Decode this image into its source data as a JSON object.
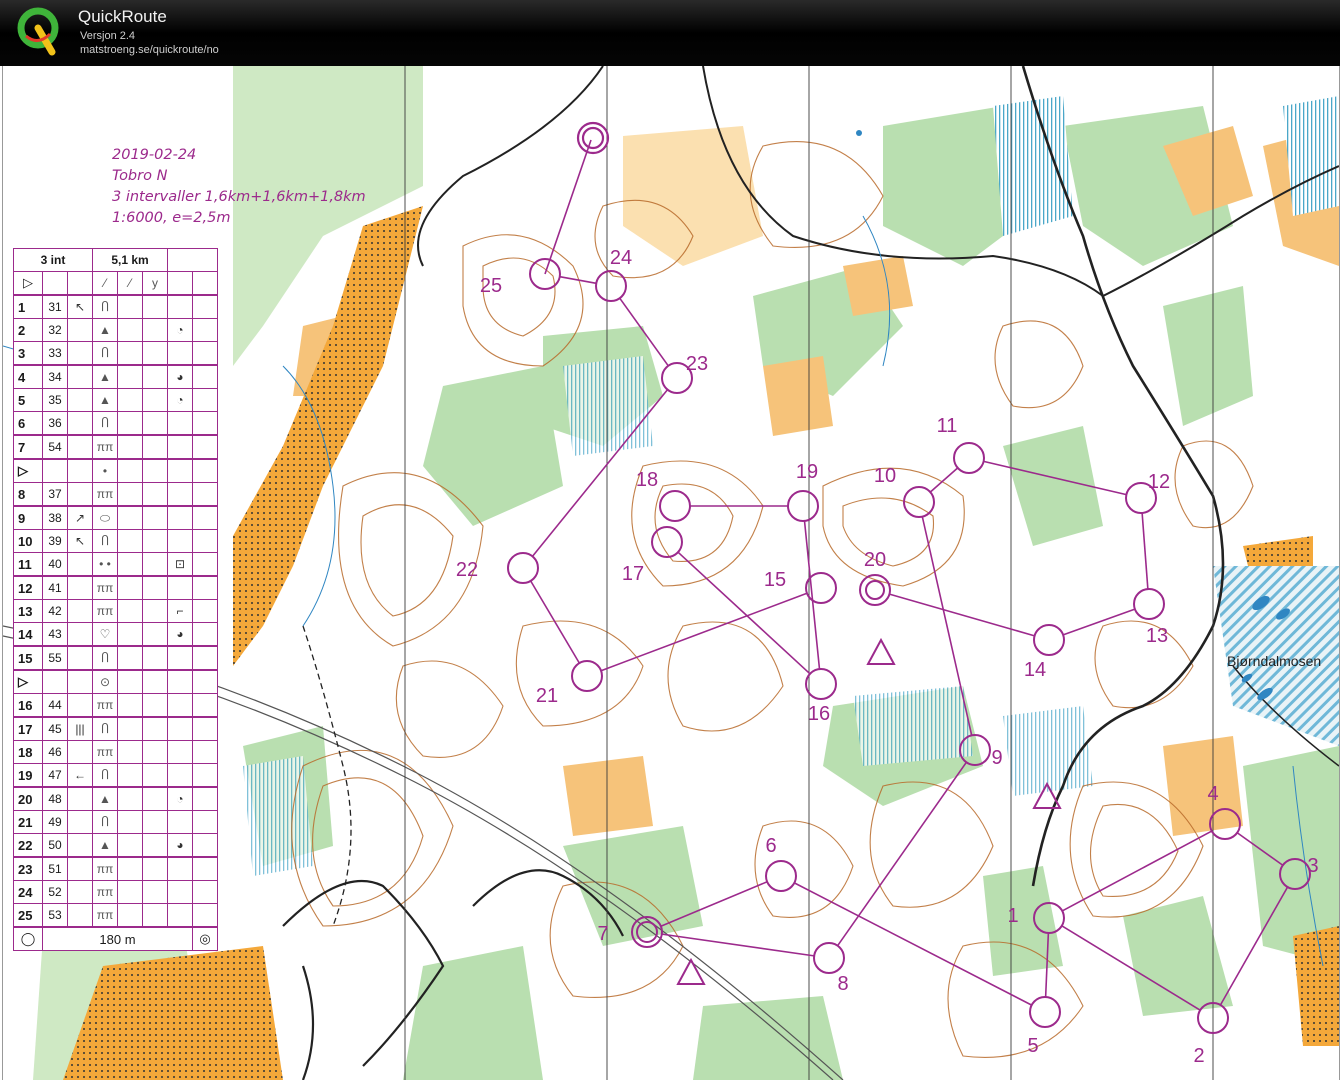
{
  "app": {
    "title": "QuickRoute",
    "version": "Versjon 2.4",
    "url": "matstroeng.se/quickroute/no"
  },
  "event": {
    "date": "2019-02-24",
    "area": "Tobro N",
    "description": "3 intervaller 1,6km+1,6km+1,8km",
    "scale": "1:6000,  e=2,5m"
  },
  "course_table": {
    "header": {
      "name": "3 int",
      "length": "5,1 km"
    },
    "footer": "180 m",
    "rows": [
      {
        "no": "1",
        "code": "31",
        "feat": "↖",
        "sym": "Ⴖ",
        "extra": ""
      },
      {
        "no": "2",
        "code": "32",
        "feat": "",
        "sym": "▲",
        "extra": "◔"
      },
      {
        "no": "3",
        "code": "33",
        "feat": "",
        "sym": "Ⴖ",
        "extra": ""
      },
      {
        "no": "4",
        "code": "34",
        "feat": "",
        "sym": "▲",
        "extra": "◕"
      },
      {
        "no": "5",
        "code": "35",
        "feat": "",
        "sym": "▲",
        "extra": "◔"
      },
      {
        "no": "6",
        "code": "36",
        "feat": "",
        "sym": "Ⴖ",
        "extra": ""
      },
      {
        "no": "7",
        "code": "54",
        "feat": "",
        "sym": "ππ",
        "extra": ""
      },
      {
        "no": "▷",
        "code": "",
        "feat": "",
        "sym": "•",
        "extra": ""
      },
      {
        "no": "8",
        "code": "37",
        "feat": "",
        "sym": "ππ",
        "extra": ""
      },
      {
        "no": "9",
        "code": "38",
        "feat": "↗",
        "sym": "⬭",
        "extra": ""
      },
      {
        "no": "10",
        "code": "39",
        "feat": "↖",
        "sym": "Ⴖ",
        "extra": ""
      },
      {
        "no": "11",
        "code": "40",
        "feat": "",
        "sym": "• •",
        "extra": "⊡"
      },
      {
        "no": "12",
        "code": "41",
        "feat": "",
        "sym": "ππ",
        "extra": ""
      },
      {
        "no": "13",
        "code": "42",
        "feat": "",
        "sym": "ππ",
        "extra": "⌐"
      },
      {
        "no": "14",
        "code": "43",
        "feat": "",
        "sym": "♡",
        "extra": "◕"
      },
      {
        "no": "15",
        "code": "55",
        "feat": "",
        "sym": "Ⴖ",
        "extra": ""
      },
      {
        "no": "▷",
        "code": "",
        "feat": "",
        "sym": "⊙",
        "extra": ""
      },
      {
        "no": "16",
        "code": "44",
        "feat": "",
        "sym": "ππ",
        "extra": ""
      },
      {
        "no": "17",
        "code": "45",
        "feat": "|||",
        "sym": "Ⴖ",
        "extra": ""
      },
      {
        "no": "18",
        "code": "46",
        "feat": "",
        "sym": "ππ",
        "extra": ""
      },
      {
        "no": "19",
        "code": "47",
        "feat": "←",
        "sym": "Ⴖ",
        "extra": ""
      },
      {
        "no": "20",
        "code": "48",
        "feat": "",
        "sym": "▲",
        "extra": "◔"
      },
      {
        "no": "21",
        "code": "49",
        "feat": "",
        "sym": "Ⴖ",
        "extra": ""
      },
      {
        "no": "22",
        "code": "50",
        "feat": "",
        "sym": "▲",
        "extra": "◕"
      },
      {
        "no": "23",
        "code": "51",
        "feat": "",
        "sym": "ππ",
        "extra": ""
      },
      {
        "no": "24",
        "code": "52",
        "feat": "",
        "sym": "ππ",
        "extra": ""
      },
      {
        "no": "25",
        "code": "53",
        "feat": "",
        "sym": "ππ",
        "extra": ""
      }
    ]
  },
  "map": {
    "place_name": "Bjørndalmosen",
    "colors": {
      "course": "#9c2a8c",
      "forest": "#ffffff",
      "open": "#f6c37a",
      "green": "#b9dfb0",
      "contour": "#b86a2a"
    },
    "controls": [
      {
        "id": "1",
        "label": "1"
      },
      {
        "id": "2",
        "label": "2"
      },
      {
        "id": "3",
        "label": "3"
      },
      {
        "id": "4",
        "label": "4"
      },
      {
        "id": "5",
        "label": "5"
      },
      {
        "id": "6",
        "label": "6"
      },
      {
        "id": "7",
        "label": "7"
      },
      {
        "id": "8",
        "label": "8"
      },
      {
        "id": "9",
        "label": "9"
      },
      {
        "id": "10",
        "label": "10"
      },
      {
        "id": "11",
        "label": "11"
      },
      {
        "id": "12",
        "label": "12"
      },
      {
        "id": "13",
        "label": "13"
      },
      {
        "id": "14",
        "label": "14"
      },
      {
        "id": "15",
        "label": "15"
      },
      {
        "id": "16",
        "label": "16"
      },
      {
        "id": "17",
        "label": "17"
      },
      {
        "id": "18",
        "label": "18"
      },
      {
        "id": "19",
        "label": "19"
      },
      {
        "id": "20",
        "label": "20"
      },
      {
        "id": "21",
        "label": "21"
      },
      {
        "id": "22",
        "label": "22"
      },
      {
        "id": "23",
        "label": "23"
      },
      {
        "id": "24",
        "label": "24"
      },
      {
        "id": "25",
        "label": "25"
      }
    ]
  }
}
